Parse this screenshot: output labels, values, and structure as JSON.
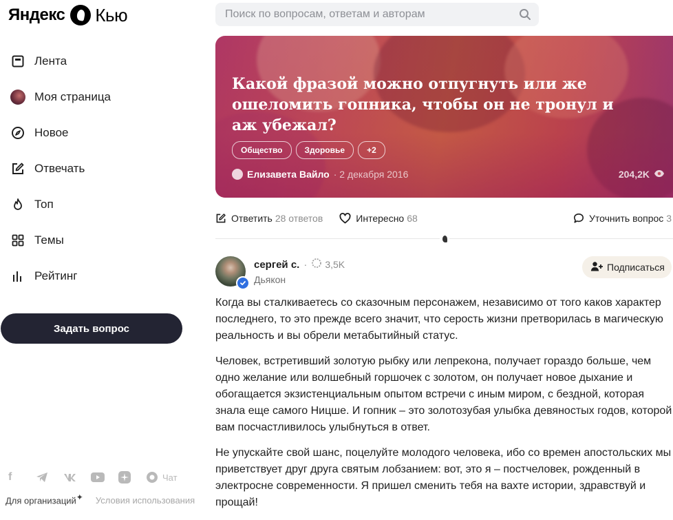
{
  "sidebar": {
    "logo": {
      "brand": "Яндекс",
      "product": "Кью"
    },
    "nav": [
      {
        "label": "Лента",
        "icon": "feed-icon"
      },
      {
        "label": "Моя страница",
        "icon": "avatar"
      },
      {
        "label": "Новое",
        "icon": "compass-icon"
      },
      {
        "label": "Отвечать",
        "icon": "edit-icon"
      },
      {
        "label": "Топ",
        "icon": "fire-icon"
      },
      {
        "label": "Темы",
        "icon": "grid-icon"
      },
      {
        "label": "Рейтинг",
        "icon": "rating-icon"
      }
    ],
    "ask_button": "Задать вопрос",
    "social": {
      "facebook": "f",
      "chat": "Чат"
    },
    "footer": {
      "org": "Для организаций",
      "org_mark": "✦",
      "terms": "Условия использования"
    }
  },
  "search": {
    "placeholder": "Поиск по вопросам, ответам и авторам"
  },
  "question": {
    "title": "Какой фразой можно отпугнуть или же ошеломить гопника, чтобы он не тронул и аж убежал?",
    "tags": [
      "Общество",
      "Здоровье",
      "+2"
    ],
    "author": "Елизавета Вайло",
    "date": "· 2 декабря 2016",
    "views": "204,2K"
  },
  "actions": {
    "answer": {
      "label": "Ответить",
      "count": "28 ответов"
    },
    "interesting": {
      "label": "Интересно",
      "count": "68"
    },
    "clarify": {
      "label": "Уточнить вопрос",
      "count": "3"
    }
  },
  "answer": {
    "author": "сергей с.",
    "separator": "·",
    "rating": "3,5K",
    "role": "Дьякон",
    "subscribe": "Подписаться",
    "paragraphs": [
      "Когда вы сталкиваетесь со сказочным персонажем, независимо от того каков характер последнего, то это прежде всего значит, что серость жизни претворилась в магическую реальность и вы обрели метабытийный статус.",
      "Человек, встретивший золотую рыбку или лепрекона, получает гораздо больше, чем одно желание или волшебный горшочек с золотом, он получает новое дыхание и обогащается экзистенциальным опытом встречи с иным миром, с бездной, которая знала еще самого Ницше. И гопник – это золотозубая улыбка девяностых годов, которой вам посчастливилось улыбнуться в ответ.",
      "Не упускайте свой шанс, поцелуйте молодого человека, ибо со времен апостольских мы приветствует друг друга святым лобзанием: вот, это я – постчеловек, рожденный в электросне современности. Я пришел сменить тебя на вахте истории, здравствуй и прощай!"
    ]
  },
  "colors": {
    "accent_dark": "#232433",
    "verified": "#2f6fe0"
  }
}
